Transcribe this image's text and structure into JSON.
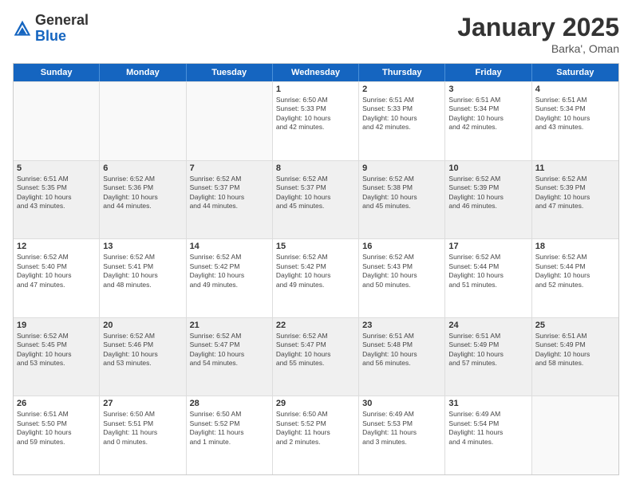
{
  "header": {
    "logo_general": "General",
    "logo_blue": "Blue",
    "month_title": "January 2025",
    "subtitle": "Barka', Oman"
  },
  "weekdays": [
    "Sunday",
    "Monday",
    "Tuesday",
    "Wednesday",
    "Thursday",
    "Friday",
    "Saturday"
  ],
  "rows": [
    [
      {
        "day": "",
        "info": ""
      },
      {
        "day": "",
        "info": ""
      },
      {
        "day": "",
        "info": ""
      },
      {
        "day": "1",
        "info": "Sunrise: 6:50 AM\nSunset: 5:33 PM\nDaylight: 10 hours\nand 42 minutes."
      },
      {
        "day": "2",
        "info": "Sunrise: 6:51 AM\nSunset: 5:33 PM\nDaylight: 10 hours\nand 42 minutes."
      },
      {
        "day": "3",
        "info": "Sunrise: 6:51 AM\nSunset: 5:34 PM\nDaylight: 10 hours\nand 42 minutes."
      },
      {
        "day": "4",
        "info": "Sunrise: 6:51 AM\nSunset: 5:34 PM\nDaylight: 10 hours\nand 43 minutes."
      }
    ],
    [
      {
        "day": "5",
        "info": "Sunrise: 6:51 AM\nSunset: 5:35 PM\nDaylight: 10 hours\nand 43 minutes."
      },
      {
        "day": "6",
        "info": "Sunrise: 6:52 AM\nSunset: 5:36 PM\nDaylight: 10 hours\nand 44 minutes."
      },
      {
        "day": "7",
        "info": "Sunrise: 6:52 AM\nSunset: 5:37 PM\nDaylight: 10 hours\nand 44 minutes."
      },
      {
        "day": "8",
        "info": "Sunrise: 6:52 AM\nSunset: 5:37 PM\nDaylight: 10 hours\nand 45 minutes."
      },
      {
        "day": "9",
        "info": "Sunrise: 6:52 AM\nSunset: 5:38 PM\nDaylight: 10 hours\nand 45 minutes."
      },
      {
        "day": "10",
        "info": "Sunrise: 6:52 AM\nSunset: 5:39 PM\nDaylight: 10 hours\nand 46 minutes."
      },
      {
        "day": "11",
        "info": "Sunrise: 6:52 AM\nSunset: 5:39 PM\nDaylight: 10 hours\nand 47 minutes."
      }
    ],
    [
      {
        "day": "12",
        "info": "Sunrise: 6:52 AM\nSunset: 5:40 PM\nDaylight: 10 hours\nand 47 minutes."
      },
      {
        "day": "13",
        "info": "Sunrise: 6:52 AM\nSunset: 5:41 PM\nDaylight: 10 hours\nand 48 minutes."
      },
      {
        "day": "14",
        "info": "Sunrise: 6:52 AM\nSunset: 5:42 PM\nDaylight: 10 hours\nand 49 minutes."
      },
      {
        "day": "15",
        "info": "Sunrise: 6:52 AM\nSunset: 5:42 PM\nDaylight: 10 hours\nand 49 minutes."
      },
      {
        "day": "16",
        "info": "Sunrise: 6:52 AM\nSunset: 5:43 PM\nDaylight: 10 hours\nand 50 minutes."
      },
      {
        "day": "17",
        "info": "Sunrise: 6:52 AM\nSunset: 5:44 PM\nDaylight: 10 hours\nand 51 minutes."
      },
      {
        "day": "18",
        "info": "Sunrise: 6:52 AM\nSunset: 5:44 PM\nDaylight: 10 hours\nand 52 minutes."
      }
    ],
    [
      {
        "day": "19",
        "info": "Sunrise: 6:52 AM\nSunset: 5:45 PM\nDaylight: 10 hours\nand 53 minutes."
      },
      {
        "day": "20",
        "info": "Sunrise: 6:52 AM\nSunset: 5:46 PM\nDaylight: 10 hours\nand 53 minutes."
      },
      {
        "day": "21",
        "info": "Sunrise: 6:52 AM\nSunset: 5:47 PM\nDaylight: 10 hours\nand 54 minutes."
      },
      {
        "day": "22",
        "info": "Sunrise: 6:52 AM\nSunset: 5:47 PM\nDaylight: 10 hours\nand 55 minutes."
      },
      {
        "day": "23",
        "info": "Sunrise: 6:51 AM\nSunset: 5:48 PM\nDaylight: 10 hours\nand 56 minutes."
      },
      {
        "day": "24",
        "info": "Sunrise: 6:51 AM\nSunset: 5:49 PM\nDaylight: 10 hours\nand 57 minutes."
      },
      {
        "day": "25",
        "info": "Sunrise: 6:51 AM\nSunset: 5:49 PM\nDaylight: 10 hours\nand 58 minutes."
      }
    ],
    [
      {
        "day": "26",
        "info": "Sunrise: 6:51 AM\nSunset: 5:50 PM\nDaylight: 10 hours\nand 59 minutes."
      },
      {
        "day": "27",
        "info": "Sunrise: 6:50 AM\nSunset: 5:51 PM\nDaylight: 11 hours\nand 0 minutes."
      },
      {
        "day": "28",
        "info": "Sunrise: 6:50 AM\nSunset: 5:52 PM\nDaylight: 11 hours\nand 1 minute."
      },
      {
        "day": "29",
        "info": "Sunrise: 6:50 AM\nSunset: 5:52 PM\nDaylight: 11 hours\nand 2 minutes."
      },
      {
        "day": "30",
        "info": "Sunrise: 6:49 AM\nSunset: 5:53 PM\nDaylight: 11 hours\nand 3 minutes."
      },
      {
        "day": "31",
        "info": "Sunrise: 6:49 AM\nSunset: 5:54 PM\nDaylight: 11 hours\nand 4 minutes."
      },
      {
        "day": "",
        "info": ""
      }
    ]
  ]
}
